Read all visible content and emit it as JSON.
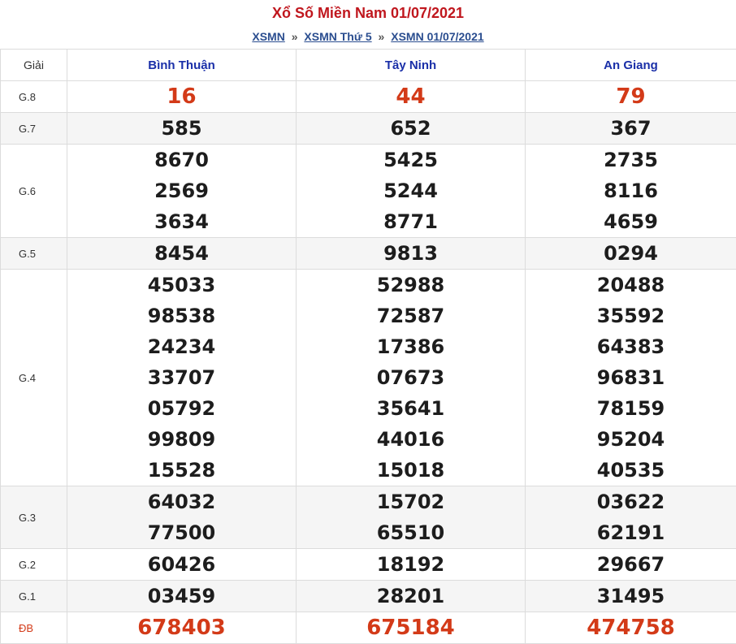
{
  "title": "Xổ Số Miền Nam 01/07/2021",
  "breadcrumb": [
    {
      "label": "XSMN"
    },
    {
      "label": "XSMN Thứ 5"
    },
    {
      "label": "XSMN 01/07/2021"
    }
  ],
  "breadcrumb_sep": "»",
  "table": {
    "header_giai": "Giải",
    "provinces": [
      "Bình Thuận",
      "Tây Ninh",
      "An Giang"
    ],
    "rows": [
      {
        "label": "G.8",
        "values": [
          [
            "16"
          ],
          [
            "44"
          ],
          [
            "79"
          ]
        ]
      },
      {
        "label": "G.7",
        "values": [
          [
            "585"
          ],
          [
            "652"
          ],
          [
            "367"
          ]
        ]
      },
      {
        "label": "G.6",
        "values": [
          [
            "8670",
            "2569",
            "3634"
          ],
          [
            "5425",
            "5244",
            "8771"
          ],
          [
            "2735",
            "8116",
            "4659"
          ]
        ]
      },
      {
        "label": "G.5",
        "values": [
          [
            "8454"
          ],
          [
            "9813"
          ],
          [
            "0294"
          ]
        ]
      },
      {
        "label": "G.4",
        "values": [
          [
            "45033",
            "98538",
            "24234",
            "33707",
            "05792",
            "99809",
            "15528"
          ],
          [
            "52988",
            "72587",
            "17386",
            "07673",
            "35641",
            "44016",
            "15018"
          ],
          [
            "20488",
            "35592",
            "64383",
            "96831",
            "78159",
            "95204",
            "40535"
          ]
        ]
      },
      {
        "label": "G.3",
        "values": [
          [
            "64032",
            "77500"
          ],
          [
            "15702",
            "65510"
          ],
          [
            "03622",
            "62191"
          ]
        ]
      },
      {
        "label": "G.2",
        "values": [
          [
            "60426"
          ],
          [
            "18192"
          ],
          [
            "29667"
          ]
        ]
      },
      {
        "label": "G.1",
        "values": [
          [
            "03459"
          ],
          [
            "28201"
          ],
          [
            "31495"
          ]
        ]
      },
      {
        "label": "ĐB",
        "values": [
          [
            "678403"
          ],
          [
            "675184"
          ],
          [
            "474758"
          ]
        ]
      }
    ]
  },
  "colors": {
    "title": "#c0171e",
    "link": "#2a4d8f",
    "province_header": "#1a2fa8",
    "special_numbers": "#d33a18",
    "numbers": "#1d1d1d",
    "alt_row_bg": "#f5f5f5"
  }
}
